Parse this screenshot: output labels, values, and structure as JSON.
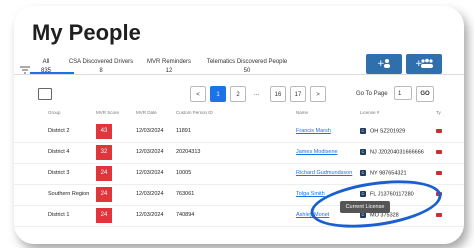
{
  "page": {
    "title": "My People"
  },
  "tabs": [
    {
      "label": "All",
      "count": "835"
    },
    {
      "label": "CSA Discovered Drivers",
      "count": "8"
    },
    {
      "label": "MVR Reminders",
      "count": "12"
    },
    {
      "label": "Telematics Discovered People",
      "count": "50"
    }
  ],
  "actions": {
    "add_person_icon": "+person-icon",
    "add_group_icon": "+group-icon"
  },
  "pagination": {
    "prev": "<",
    "pages": [
      "1",
      "2"
    ],
    "ellipsis": "...",
    "last_pages": [
      "16",
      "17"
    ],
    "next": ">",
    "goto_label": "Go To Page",
    "goto_value": "1",
    "go_label": "GO"
  },
  "table": {
    "columns": [
      "Group",
      "MVR Score",
      "MVR Date",
      "Custom Person ID",
      "Name",
      "License #",
      "Ty"
    ],
    "rows": [
      {
        "group": "District 2",
        "score": "43",
        "date": "12/03/2024",
        "id": "11891",
        "name": "Francis Marsh",
        "license_badge": "C",
        "license": "OH SZ201929"
      },
      {
        "group": "District 4",
        "score": "32",
        "date": "12/03/2024",
        "id": "20204313",
        "name": "James Modisene",
        "license_badge": "C",
        "license": "NJ J20204031666666"
      },
      {
        "group": "District 3",
        "score": "24",
        "date": "12/03/2024",
        "id": "10005",
        "name": "Richard Gudmundsson",
        "license_badge": "C",
        "license": "NY 987654321"
      },
      {
        "group": "Southern Region",
        "score": "24",
        "date": "12/03/2024",
        "id": "763061",
        "name": "Tolga Smith",
        "license_badge": "C",
        "license": "FL J13760117280"
      },
      {
        "group": "District 1",
        "score": "24",
        "date": "12/03/2024",
        "id": "740894",
        "name": "Ashley Monet",
        "license_badge": "C",
        "license": "MO 375328"
      }
    ]
  },
  "tooltip": {
    "text": "Current License"
  },
  "colors": {
    "accent": "#1a73e8",
    "score_red": "#e0353b",
    "button_blue": "#2f6fae",
    "highlight_ring": "#1a5fd0"
  }
}
